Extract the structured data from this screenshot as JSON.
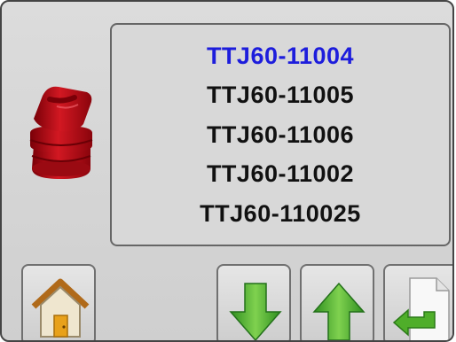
{
  "nozzle_list": {
    "items": [
      {
        "label": "TTJ60-11004",
        "selected": true
      },
      {
        "label": "TTJ60-11005",
        "selected": false
      },
      {
        "label": "TTJ60-11006",
        "selected": false
      },
      {
        "label": "TTJ60-11002",
        "selected": false
      },
      {
        "label": "TTJ60-110025",
        "selected": false
      }
    ],
    "selected_color": "#1d1ddc",
    "text_color": "#111111"
  },
  "nozzle_image": {
    "icon": "red-spray-nozzle-icon",
    "color": "#c8141e"
  },
  "toolbar": {
    "home": {
      "icon": "home-icon"
    },
    "down": {
      "icon": "arrow-down-icon",
      "color": "#3fae2a"
    },
    "up": {
      "icon": "arrow-up-icon",
      "color": "#3fae2a"
    },
    "back": {
      "icon": "return-document-icon"
    }
  }
}
